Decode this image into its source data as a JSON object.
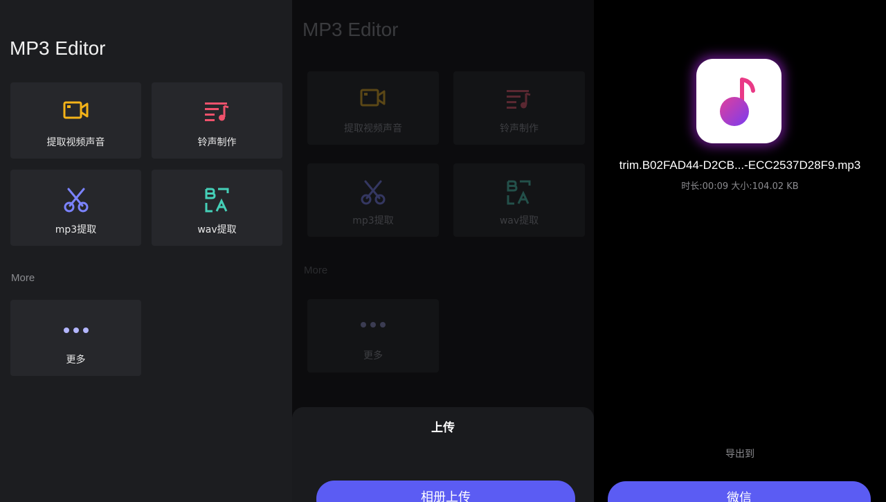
{
  "home": {
    "title": "MP3 Editor",
    "tiles": [
      {
        "label": "提取视频声音",
        "icon": "video-camera-icon",
        "color": "#f4b318"
      },
      {
        "label": "铃声制作",
        "icon": "music-list-icon",
        "color": "#f0526c"
      },
      {
        "label": "mp3提取",
        "icon": "scissors-icon",
        "color": "#7b83ff"
      },
      {
        "label": "wav提取",
        "icon": "text-ba-icon",
        "color": "#45d0b8"
      }
    ],
    "more_section": "More",
    "more_tile": {
      "label": "更多",
      "icon": "more-dots-icon"
    }
  },
  "upload_sheet": {
    "title": "上传",
    "album_button": "相册上传"
  },
  "export": {
    "file_name": "trim.B02FAD44-D2CB...-ECC2537D28F9.mp3",
    "file_meta": "时长:00:09 大小:104.02 KB",
    "export_to_label": "导出到",
    "wechat_button": "微信"
  },
  "colors": {
    "accent": "#5b5cf3",
    "panel_bg": "#1c1d20",
    "tile_bg": "#26272b"
  }
}
